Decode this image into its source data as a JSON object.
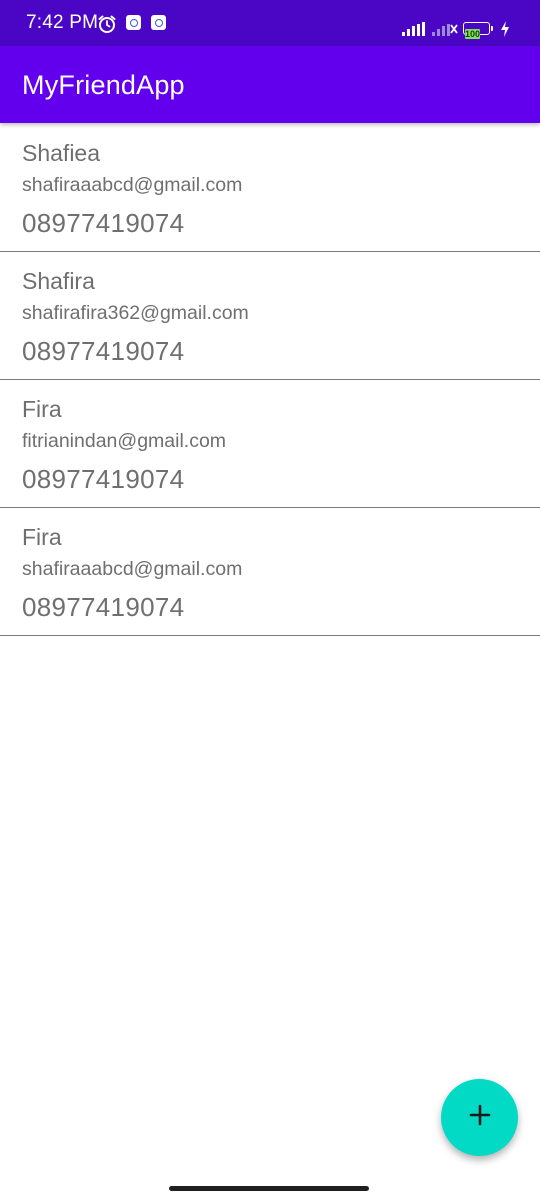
{
  "status_bar": {
    "time": "7:42 PM",
    "battery": "100",
    "icons": [
      "alarm-icon",
      "app-notification-icon",
      "app-notification-icon",
      "signal-icon",
      "signal-icon",
      "battery-icon",
      "charging-icon"
    ]
  },
  "app_bar": {
    "title": "MyFriendApp"
  },
  "friends": [
    {
      "name": "Shafiea",
      "email": "shafiraaabcd@gmail.com",
      "phone": "08977419074"
    },
    {
      "name": "Shafira",
      "email": "shafirafira362@gmail.com",
      "phone": "08977419074"
    },
    {
      "name": "Fira",
      "email": "fitrianindan@gmail.com",
      "phone": "08977419074"
    },
    {
      "name": "Fira",
      "email": "shafiraaabcd@gmail.com",
      "phone": "08977419074"
    }
  ],
  "fab": {
    "icon": "plus-icon"
  },
  "colors": {
    "status_bar": "#4A06C4",
    "primary": "#6200EE",
    "fab": "#03DAC5",
    "text_secondary": "#6f6f6f"
  }
}
